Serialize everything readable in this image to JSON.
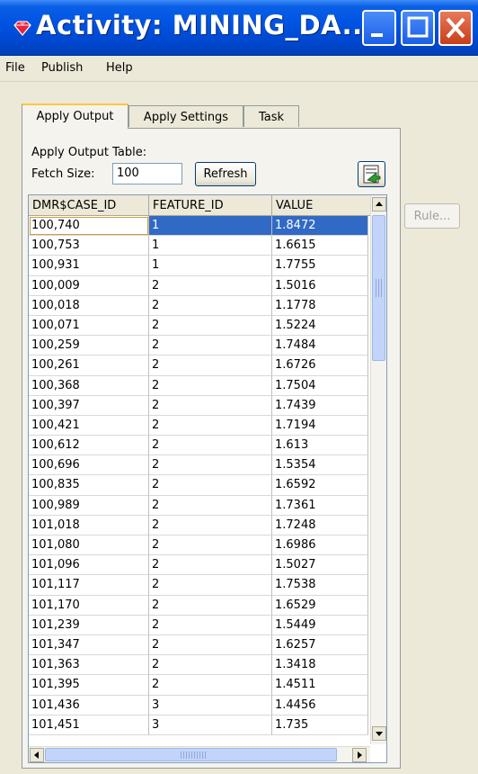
{
  "window": {
    "title": "Activity: MINING_DA...",
    "icon": "ruby-gem-icon",
    "controls": [
      "minimize",
      "maximize",
      "close"
    ]
  },
  "menu": [
    {
      "label": "File"
    },
    {
      "label": "Publish"
    },
    {
      "label": "Help"
    }
  ],
  "tabs": [
    {
      "label": "Apply Output",
      "active": true
    },
    {
      "label": "Apply Settings",
      "active": false
    },
    {
      "label": "Task",
      "active": false
    }
  ],
  "apply_output": {
    "table_label": "Apply Output Table:",
    "fetch_size_label": "Fetch Size:",
    "fetch_size_value": "100",
    "refresh_label": "Refresh",
    "rule_label": "Rule...",
    "export_icon": "export-icon"
  },
  "table": {
    "columns": [
      "DMR$CASE_ID",
      "FEATURE_ID",
      "VALUE"
    ],
    "selected_row": 0,
    "rows": [
      [
        "100,740",
        "1",
        "1.8472"
      ],
      [
        "100,753",
        "1",
        "1.6615"
      ],
      [
        "100,931",
        "1",
        "1.7755"
      ],
      [
        "100,009",
        "2",
        "1.5016"
      ],
      [
        "100,018",
        "2",
        "1.1778"
      ],
      [
        "100,071",
        "2",
        "1.5224"
      ],
      [
        "100,259",
        "2",
        "1.7484"
      ],
      [
        "100,261",
        "2",
        "1.6726"
      ],
      [
        "100,368",
        "2",
        "1.7504"
      ],
      [
        "100,397",
        "2",
        "1.7439"
      ],
      [
        "100,421",
        "2",
        "1.7194"
      ],
      [
        "100,612",
        "2",
        "1.613"
      ],
      [
        "100,696",
        "2",
        "1.5354"
      ],
      [
        "100,835",
        "2",
        "1.6592"
      ],
      [
        "100,989",
        "2",
        "1.7361"
      ],
      [
        "101,018",
        "2",
        "1.7248"
      ],
      [
        "101,080",
        "2",
        "1.6986"
      ],
      [
        "101,096",
        "2",
        "1.5027"
      ],
      [
        "101,117",
        "2",
        "1.7538"
      ],
      [
        "101,170",
        "2",
        "1.6529"
      ],
      [
        "101,239",
        "2",
        "1.5449"
      ],
      [
        "101,347",
        "2",
        "1.6257"
      ],
      [
        "101,363",
        "2",
        "1.3418"
      ],
      [
        "101,395",
        "2",
        "1.4511"
      ],
      [
        "101,436",
        "3",
        "1.4456"
      ],
      [
        "101,451",
        "3",
        "1.735"
      ]
    ]
  },
  "colors": {
    "titlebar": "#0054e3",
    "selection": "#316ac5",
    "close_button": "#c83e1a"
  }
}
